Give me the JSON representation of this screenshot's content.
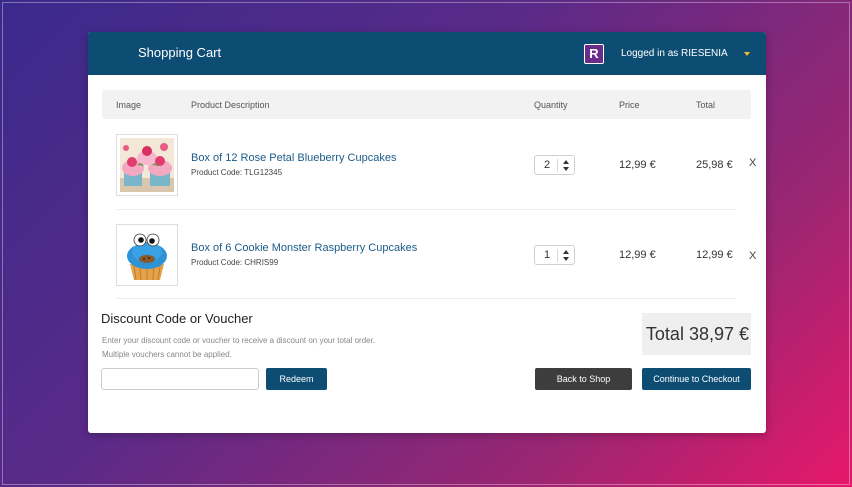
{
  "header": {
    "title": "Shopping Cart",
    "logo_letter": "R",
    "user_text": "Logged in as RIESENIA"
  },
  "table": {
    "columns": [
      "Image",
      "Product Description",
      "Quantity",
      "Price",
      "Total"
    ]
  },
  "items": [
    {
      "name": "Box of 12 Rose Petal Blueberry Cupcakes",
      "code": "Product Code: TLG12345",
      "quantity": "2",
      "price": "12,99 €",
      "total": "25,98 €",
      "remove": "X"
    },
    {
      "name": "Box of 6 Cookie Monster Raspberry Cupcakes",
      "code": "Product Code: CHRIS99",
      "quantity": "1",
      "price": "12,99 €",
      "total": "12,99 €",
      "remove": "X"
    }
  ],
  "discount": {
    "title": "Discount Code or Voucher",
    "help_line1": "Enter your discount code or voucher to receive a discount on your total order.",
    "help_line2": "Multiple vouchers  cannot be applied.",
    "input_value": "",
    "redeem_label": "Redeem"
  },
  "summary": {
    "total_label": "Total 38,97 €"
  },
  "actions": {
    "back_label": "Back to Shop",
    "checkout_label": "Continue to Checkout"
  },
  "colors": {
    "header_bg": "#0e4d73",
    "accent": "#0e4d73",
    "link": "#1b5b8a",
    "caret": "#f2c02a",
    "logo_bg": "#6a2c8a"
  }
}
